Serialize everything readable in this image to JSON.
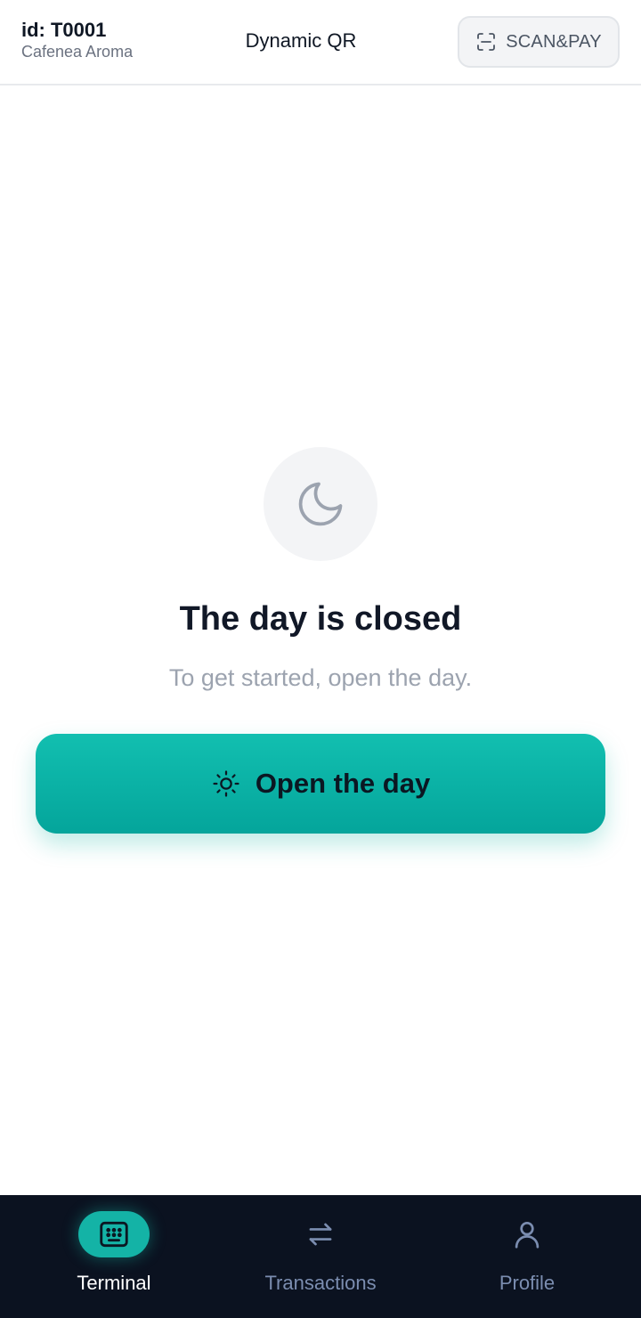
{
  "header": {
    "terminal_id": "id: T0001",
    "merchant_name": "Cafenea Aroma",
    "title": "Dynamic QR",
    "scan_button": {
      "label": "SCAN&PAY",
      "icon": "scan-icon"
    }
  },
  "main": {
    "status_icon": "moon-icon",
    "title": "The day is closed",
    "subtitle": "To get started, open the day.",
    "open_button": {
      "label": "Open the day",
      "icon": "sun-icon"
    }
  },
  "bottom_nav": {
    "items": [
      {
        "label": "Terminal",
        "icon": "keypad-icon",
        "active": true
      },
      {
        "label": "Transactions",
        "icon": "swap-arrows-icon",
        "active": false
      },
      {
        "label": "Profile",
        "icon": "user-icon",
        "active": false
      }
    ]
  },
  "colors": {
    "accent": "#14b3a6",
    "nav_background": "#0b1220",
    "nav_inactive": "#7b8db0",
    "title_text": "#111827",
    "muted_text": "#9ca3af"
  }
}
